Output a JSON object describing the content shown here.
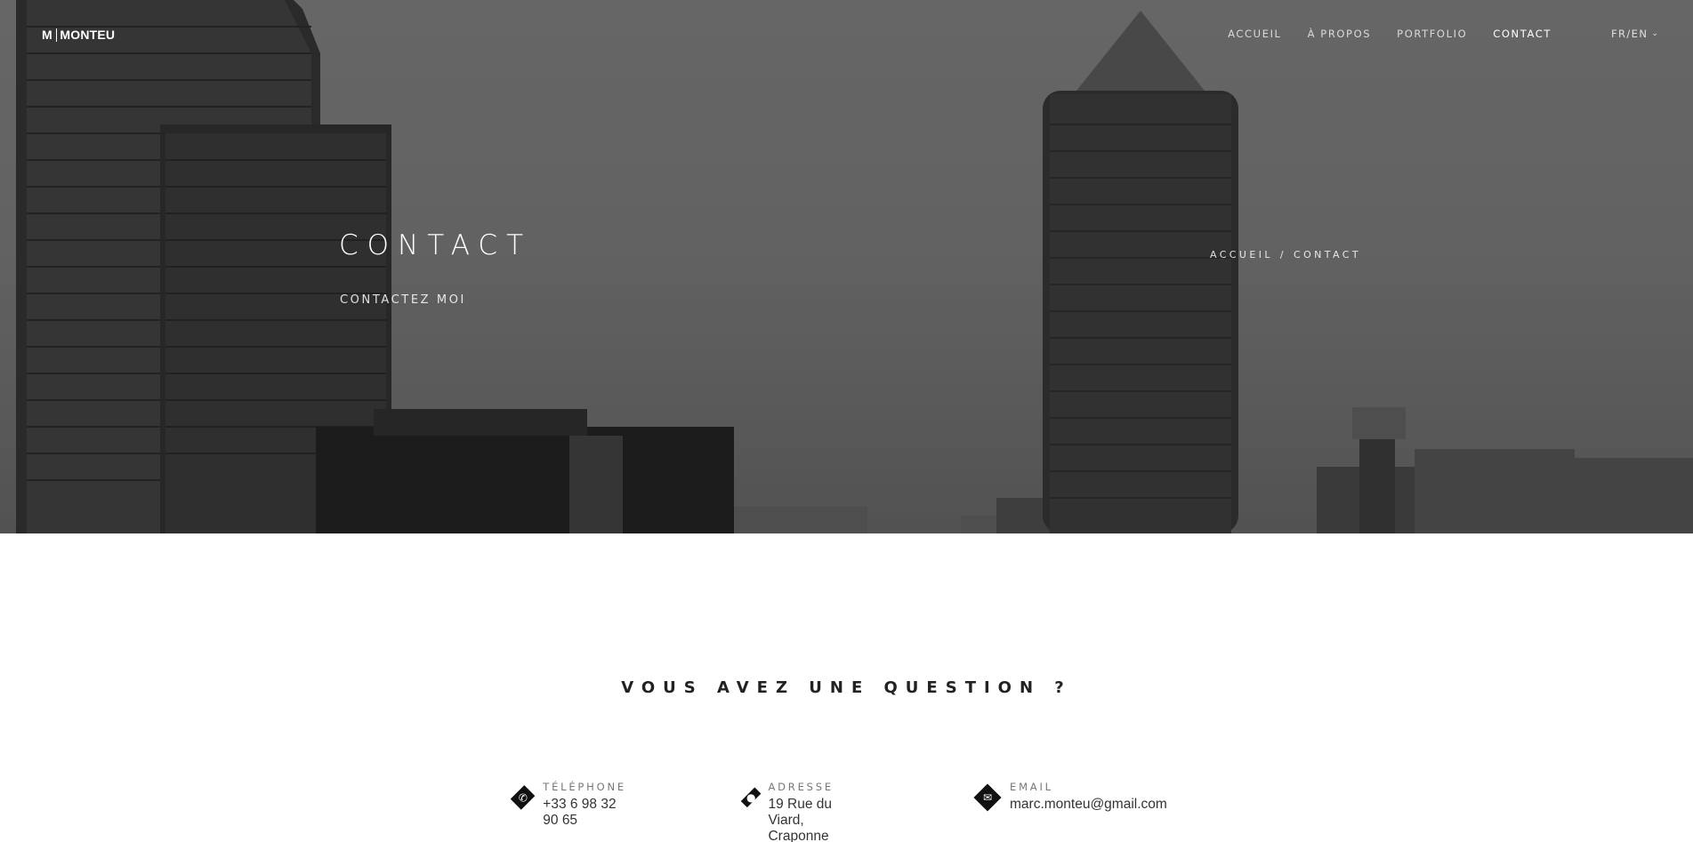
{
  "header": {
    "logo_prefix": "M",
    "logo_name": "MONTEU",
    "nav": [
      {
        "label": "ACCUEIL"
      },
      {
        "label": "À PROPOS"
      },
      {
        "label": "PORTFOLIO"
      },
      {
        "label": "CONTACT"
      }
    ],
    "active_nav": "CONTACT",
    "lang_label": "FR/EN",
    "lang_icon": "chevron-down-icon"
  },
  "hero": {
    "title": "CONTACT",
    "subtitle": "CONTACTEZ MOI",
    "breadcrumb_home": "ACCUEIL",
    "breadcrumb_sep": "/",
    "breadcrumb_current": "CONTACT"
  },
  "section": {
    "heading": "VOUS AVEZ UNE QUESTION ?"
  },
  "contacts": [
    {
      "icon": "phone-icon",
      "label": "TÉLÉPHONE",
      "value": "+33 6 98 32 90 65"
    },
    {
      "icon": "map-pin-icon",
      "label": "ADRESSE",
      "value": "19 Rue du Viard, Craponne"
    },
    {
      "icon": "envelope-icon",
      "label": "EMAIL",
      "value": "marc.monteu@gmail.com"
    }
  ],
  "colors": {
    "dark": "#111111",
    "text": "#222222",
    "muted": "#777777"
  }
}
